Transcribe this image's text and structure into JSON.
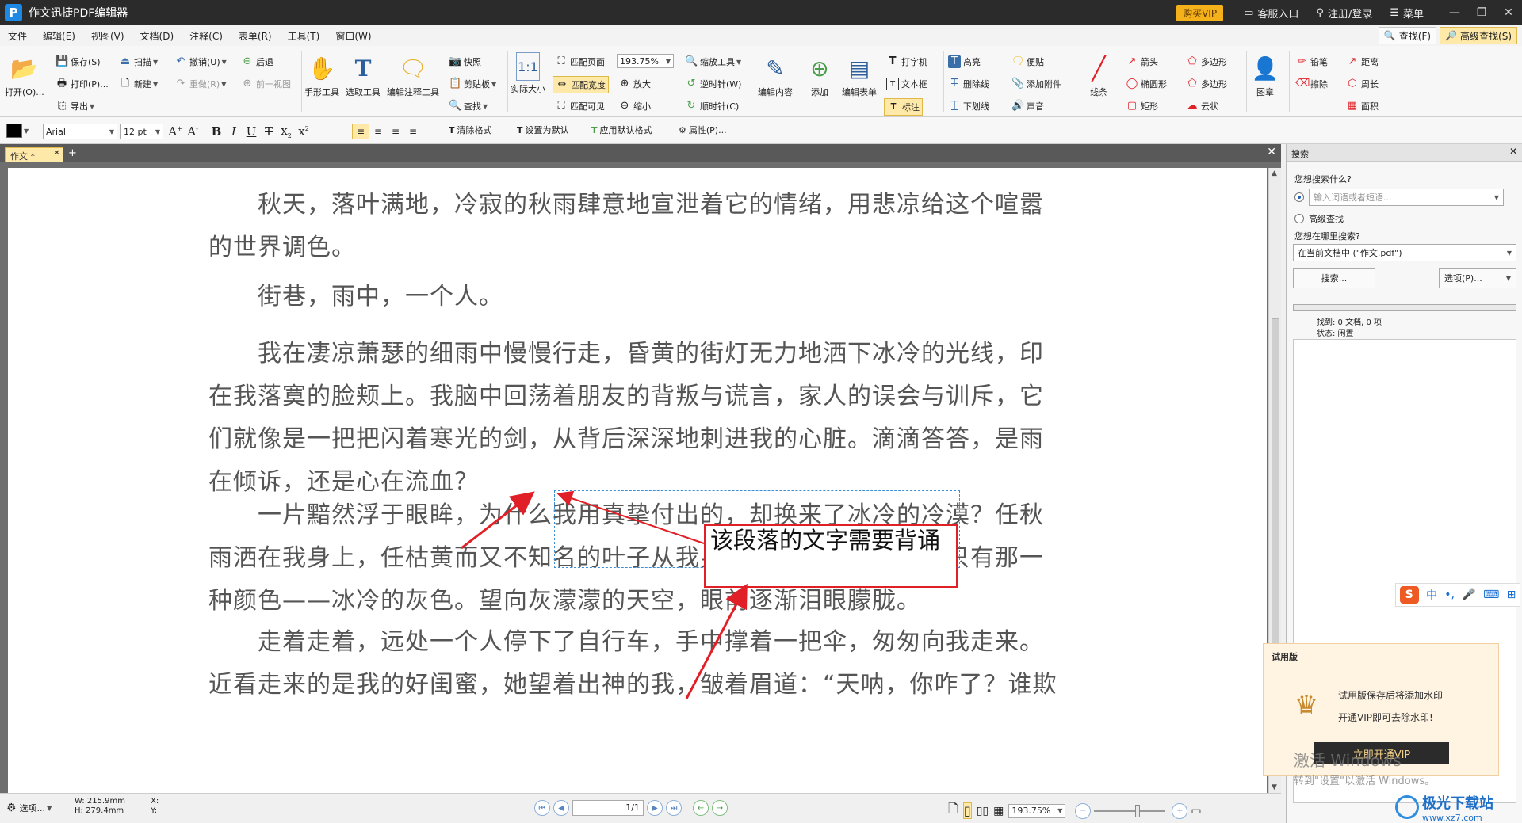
{
  "titlebar": {
    "title": "作文迅捷PDF编辑器",
    "vip": "购买VIP",
    "service": "客服入口",
    "login": "注册/登录",
    "menu": "菜单"
  },
  "menubar": {
    "items": [
      "文件",
      "编辑(E)",
      "视图(V)",
      "文档(D)",
      "注释(C)",
      "表单(R)",
      "工具(T)",
      "窗口(W)"
    ],
    "find": "查找(F)",
    "advanced_find": "高级查找(S)"
  },
  "ribbon": {
    "open": "打开(O)...",
    "save": "保存(S)",
    "print": "打印(P)...",
    "export": "导出",
    "scan": "扫描",
    "new": "新建",
    "undo": "撤销(U)",
    "redo": "重做(R)",
    "back": "后退",
    "forward": "前一视图",
    "hand_tool": "手形工具",
    "select_tool": "选取工具",
    "edit_annot_tool": "编辑注释工具",
    "snapshot": "快照",
    "clipboard": "剪贴板",
    "find": "查找",
    "actual_size": "实际大小",
    "fit_page": "匹配页面",
    "fit_width": "匹配宽度",
    "fit_visible": "匹配可见",
    "zoom_value": "193.75%",
    "zoom_tool": "缩放工具",
    "zoom_in": "放大",
    "zoom_out": "缩小",
    "ccw": "逆时针(W)",
    "cw": "顺时针(C)",
    "edit_content": "编辑内容",
    "add": "添加",
    "edit_form": "编辑表单",
    "typewriter": "打字机",
    "textbox": "文本框",
    "callout": "标注",
    "highlight": "高亮",
    "strikeout": "删除线",
    "underline": "下划线",
    "note": "便贴",
    "attach": "添加附件",
    "sound": "声音",
    "line": "线条",
    "arrow": "箭头",
    "ellipse": "椭圆形",
    "rect": "矩形",
    "polygon1": "多边形",
    "polygon2": "多边形",
    "cloud": "云状",
    "stamp": "图章",
    "pencil": "铅笔",
    "eraser": "擦除",
    "distance": "距离",
    "perimeter": "周长",
    "area": "面积"
  },
  "formatbar": {
    "font": "Arial",
    "size": "12 pt",
    "clear_format": "清除格式",
    "set_default": "设置为默认",
    "apply_default": "应用默认格式",
    "properties": "属性(P)..."
  },
  "tabs": {
    "doc_tab": "作文 *"
  },
  "document": {
    "paragraphs": [
      "　　秋天，落叶满地，冷寂的秋雨肆意地宣泄着它的情绪，用悲凉给这个喧嚣的世界调色。",
      "　　街巷，雨中，一个人。",
      "　　我在凄凉萧瑟的细雨中慢慢行走，昏黄的街灯无力地洒下冰冷的光线，印在我落寞的脸颊上。我脑中回荡着朋友的背叛与谎言，家人的误会与训斥，它们就像是一把把闪着寒光的剑，从背后深深地刺进我的心脏。滴滴答答，是雨在倾诉，还是心在流血？",
      "　　一片黯然浮于眼眸，为什么我用真挚付出的，却换来了冰冷的冷漠？任秋雨洒在我身上，任枯黄而又不知名的叶子从我身旁飘落，这世界好似只有那一种颜色——冰冷的灰色。望向灰濛濛的天空，眼前逐渐泪眼朦胧。",
      "　　走着走着，远处一个人停下了自行车，手中撑着一把伞，匆匆向我走来。近看走来的是我的好闺蜜，她望着出神的我，皱着眉道：“天呐，你咋了？谁欺"
    ],
    "callout_text": "该段落的文字需要背诵"
  },
  "statusbar": {
    "options": "选项...",
    "width": "W: 215.9mm",
    "height": "H: 279.4mm",
    "x": "X:",
    "y": "Y:",
    "page": "1/1",
    "zoom": "193.75%"
  },
  "search_panel": {
    "title": "搜索",
    "question": "您想搜索什么?",
    "placeholder": "输入词语或者短语...",
    "advanced": "高级查找",
    "where": "您想在哪里搜索?",
    "scope": "在当前文档中 (\"作文.pdf\")",
    "search_btn": "搜索...",
    "options_btn": "选项(P)...",
    "found": "找到: 0 文档, 0 项",
    "status": "状态: 闲置"
  },
  "ime": {
    "lang": "中"
  },
  "trial": {
    "title": "试用版",
    "line1": "试用版保存后将添加水印",
    "line2": "开通VIP即可去除水印!",
    "cta": "立即开通VIP"
  },
  "watermark": {
    "line1": "激活 Windows",
    "line2": "转到\"设置\"以激活 Windows。"
  },
  "site": {
    "name": "极光下载站",
    "url": "www.xz7.com"
  }
}
